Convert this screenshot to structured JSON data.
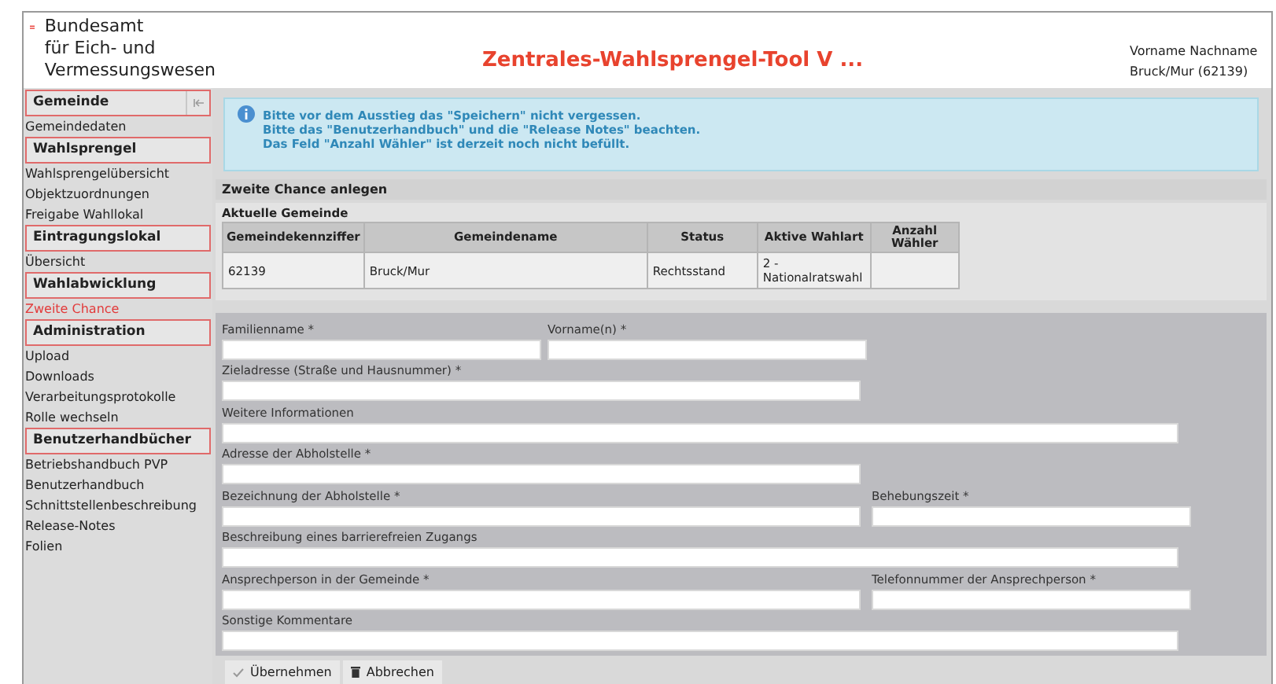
{
  "header": {
    "org_lines": [
      "Bundesamt",
      "für Eich- und",
      "Vermessungswesen"
    ],
    "title": "Zentrales-Wahlsprengel-Tool V ...",
    "user_name": "Vorname Nachname",
    "user_place": "Bruck/Mur (62139)"
  },
  "sidebar": {
    "sections": [
      {
        "title": "Gemeinde",
        "collapse_button": true,
        "items": [
          {
            "label": "Gemeindedaten",
            "selected": false
          }
        ]
      },
      {
        "title": "Wahlsprengel",
        "collapse_button": false,
        "items": [
          {
            "label": "Wahlsprengelübersicht",
            "selected": false
          },
          {
            "label": "Objektzuordnungen",
            "selected": false
          },
          {
            "label": "Freigabe Wahllokal",
            "selected": false
          }
        ]
      },
      {
        "title": "Eintragungslokal",
        "collapse_button": false,
        "items": [
          {
            "label": "Übersicht",
            "selected": false
          }
        ]
      },
      {
        "title": "Wahlabwicklung",
        "collapse_button": false,
        "items": [
          {
            "label": "Zweite Chance",
            "selected": true
          }
        ]
      },
      {
        "title": "Administration",
        "collapse_button": false,
        "items": [
          {
            "label": "Upload",
            "selected": false
          },
          {
            "label": "Downloads",
            "selected": false
          },
          {
            "label": "Verarbeitungsprotokolle",
            "selected": false
          },
          {
            "label": "Rolle wechseln",
            "selected": false
          }
        ]
      },
      {
        "title": "Benutzerhandbücher",
        "collapse_button": false,
        "items": [
          {
            "label": "Betriebshandbuch PVP",
            "selected": false
          },
          {
            "label": "Benutzerhandbuch",
            "selected": false
          },
          {
            "label": "Schnittstellenbeschreibung",
            "selected": false
          },
          {
            "label": "Release-Notes",
            "selected": false
          },
          {
            "label": "Folien",
            "selected": false
          }
        ]
      }
    ]
  },
  "info": {
    "lines": [
      "Bitte vor dem Ausstieg das \"Speichern\" nicht vergessen.",
      "Bitte das \"Benutzerhandbuch\" und die \"Release Notes\" beachten.",
      "Das Feld \"Anzahl Wähler\" ist derzeit noch nicht befüllt."
    ]
  },
  "panel_title": "Zweite Chance anlegen",
  "table": {
    "title": "Aktuelle Gemeinde",
    "columns": [
      "Gemeindekennziffer",
      "Gemeindename",
      "Status",
      "Aktive Wahlart",
      "Anzahl Wähler"
    ],
    "rows": [
      [
        "62139",
        "Bruck/Mur",
        "Rechtsstand",
        "2 - Nationalratswahl",
        ""
      ]
    ]
  },
  "form": {
    "rows": [
      [
        {
          "label": "Familienname *",
          "kind": "short"
        },
        {
          "label": "Vorname(n) *",
          "kind": "short"
        }
      ],
      [
        {
          "label": "Zieladresse (Straße und Hausnummer) *",
          "kind": "medium"
        }
      ],
      [
        {
          "label": "Weitere Informationen",
          "kind": "full"
        }
      ],
      [
        {
          "label": "Adresse der Abholstelle *",
          "kind": "medium"
        }
      ],
      [
        {
          "label": "Bezeichnung der Abholstelle *",
          "kind": "medium"
        },
        {
          "label": "Behebungszeit *",
          "kind": "short"
        }
      ],
      [
        {
          "label": "Beschreibung eines barrierefreien Zugangs",
          "kind": "full"
        }
      ],
      [
        {
          "label": "Ansprechperson in der Gemeinde *",
          "kind": "medium"
        },
        {
          "label": "Telefonnummer der Ansprechperson *",
          "kind": "short"
        }
      ],
      [
        {
          "label": "Sonstige Kommentare",
          "kind": "full"
        }
      ]
    ]
  },
  "buttons": [
    {
      "label": "Übernehmen",
      "kind": "confirm"
    },
    {
      "label": "Abbrechen",
      "kind": "cancel"
    }
  ]
}
